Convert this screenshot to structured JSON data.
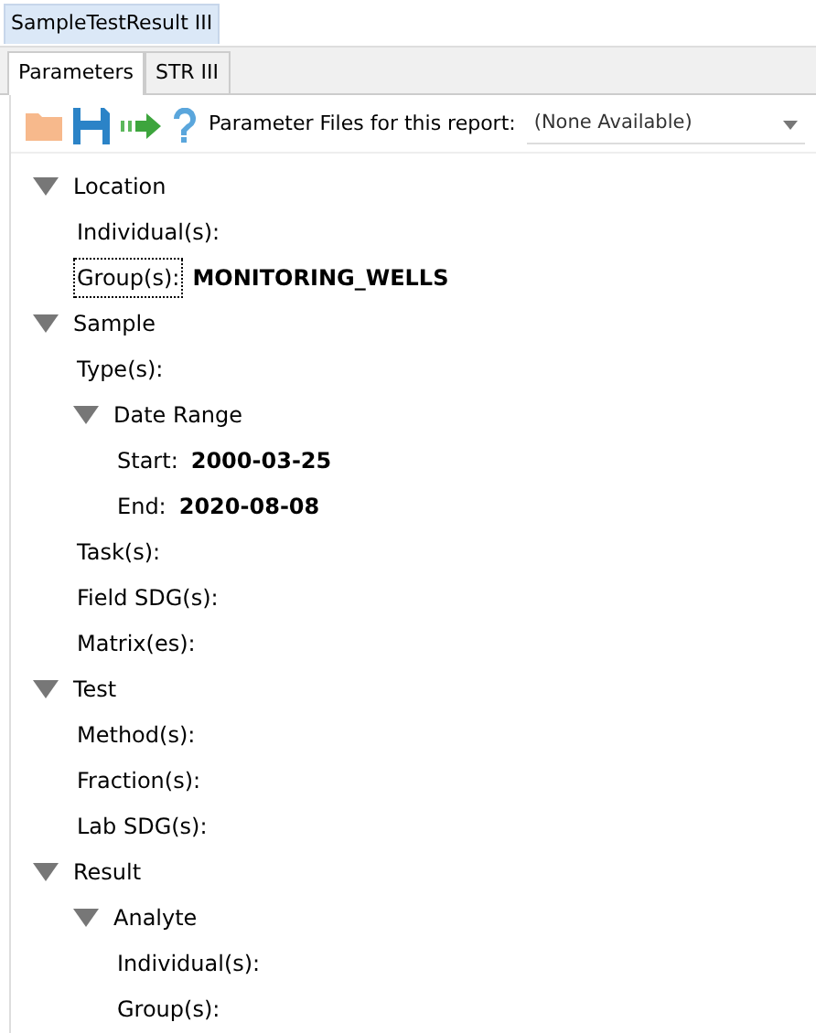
{
  "document_tab": {
    "label": "SampleTestResult III",
    "selected": true
  },
  "tabs": [
    {
      "label": "Parameters",
      "selected": true
    },
    {
      "label": "STR III",
      "selected": false
    }
  ],
  "toolbar": {
    "label": "Parameter Files for this report:",
    "dropdown": {
      "value": "(None Available)"
    }
  },
  "tree": [
    {
      "kind": "group",
      "label": "Location",
      "expanded": true,
      "children": [
        {
          "kind": "field",
          "label": "Individual(s):",
          "focused": false
        },
        {
          "kind": "field",
          "label": "Group(s):",
          "value": "MONITORING_WELLS",
          "focused": true
        }
      ]
    },
    {
      "kind": "group",
      "label": "Sample",
      "expanded": true,
      "children": [
        {
          "kind": "field",
          "label": "Type(s):",
          "focused": false
        },
        {
          "kind": "group",
          "label": "Date Range",
          "expanded": true,
          "children": [
            {
              "kind": "field",
              "label": "Start:",
              "value": "2000-03-25",
              "focused": false
            },
            {
              "kind": "field",
              "label": "End:",
              "value": "2020-08-08",
              "focused": false
            }
          ]
        },
        {
          "kind": "field",
          "label": "Task(s):",
          "focused": false
        },
        {
          "kind": "field",
          "label": "Field SDG(s):",
          "focused": false
        },
        {
          "kind": "field",
          "label": "Matrix(es):",
          "focused": false
        }
      ]
    },
    {
      "kind": "group",
      "label": "Test",
      "expanded": true,
      "children": [
        {
          "kind": "field",
          "label": "Method(s):",
          "focused": false
        },
        {
          "kind": "field",
          "label": "Fraction(s):",
          "focused": false
        },
        {
          "kind": "field",
          "label": "Lab SDG(s):",
          "focused": false
        }
      ]
    },
    {
      "kind": "group",
      "label": "Result",
      "expanded": true,
      "children": [
        {
          "kind": "group",
          "label": "Analyte",
          "expanded": true,
          "children": [
            {
              "kind": "field",
              "label": "Individual(s):",
              "focused": false
            },
            {
              "kind": "field",
              "label": "Group(s):",
              "focused": false
            }
          ]
        }
      ]
    }
  ]
}
